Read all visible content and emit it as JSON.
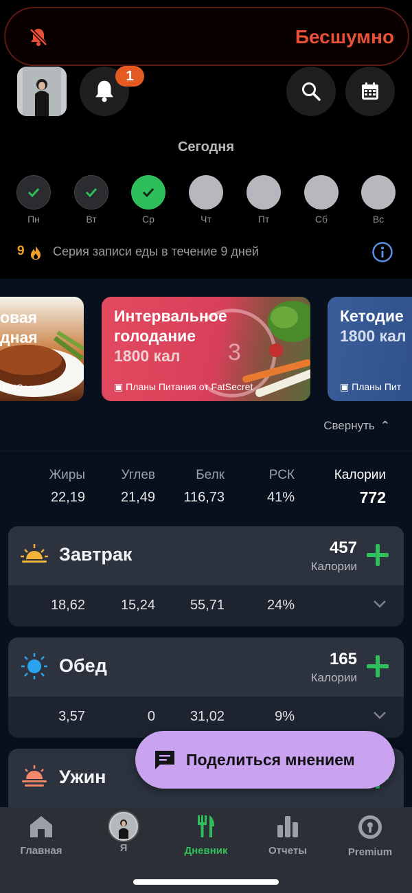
{
  "silent_banner": {
    "label": "Бесшумно"
  },
  "notifications": {
    "count": "1"
  },
  "header": {
    "title": "Сегодня"
  },
  "week": [
    {
      "label": "Пн",
      "state": "done"
    },
    {
      "label": "Вт",
      "state": "done"
    },
    {
      "label": "Ср",
      "state": "today"
    },
    {
      "label": "Чт",
      "state": "future"
    },
    {
      "label": "Пт",
      "state": "future"
    },
    {
      "label": "Сб",
      "state": "future"
    },
    {
      "label": "Вс",
      "state": "future"
    }
  ],
  "streak": {
    "count": "9",
    "text": "Серия записи еды в течение 9 дней"
  },
  "plans": [
    {
      "title_line1": "овая",
      "title_line2": "дная",
      "calories": "",
      "footer": "FatSecret"
    },
    {
      "title_line1": "Интервальное",
      "title_line2": "голодание",
      "calories": "1800 кал",
      "footer": "Планы Питания от FatSecret"
    },
    {
      "title_line1": "Кетодие",
      "title_line2": "",
      "calories": "1800 кал",
      "footer": "Планы Пит"
    }
  ],
  "collapse_label": "Свернуть",
  "totals": {
    "headers": [
      "Жиры",
      "Углев",
      "Белк",
      "РСК",
      "Калории"
    ],
    "values": [
      "22,19",
      "21,49",
      "116,73",
      "41%",
      "772"
    ]
  },
  "meals": [
    {
      "name": "Завтрак",
      "calories": "457",
      "calories_label": "Калории",
      "values": [
        "18,62",
        "15,24",
        "55,71",
        "24%"
      ]
    },
    {
      "name": "Обед",
      "calories": "165",
      "calories_label": "Калории",
      "values": [
        "3,57",
        "0",
        "31,02",
        "9%"
      ]
    },
    {
      "name": "Ужин"
    }
  ],
  "feedback_button": "Поделиться мнением",
  "tabs": [
    {
      "label": "Главная"
    },
    {
      "label": "Я"
    },
    {
      "label": "Дневник"
    },
    {
      "label": "Отчеты"
    },
    {
      "label": "Premium"
    }
  ],
  "colors": {
    "accent": "#2fbf5a",
    "streak": "#f0a025",
    "silent": "#e8503a",
    "fab": "#c9a2f0"
  }
}
